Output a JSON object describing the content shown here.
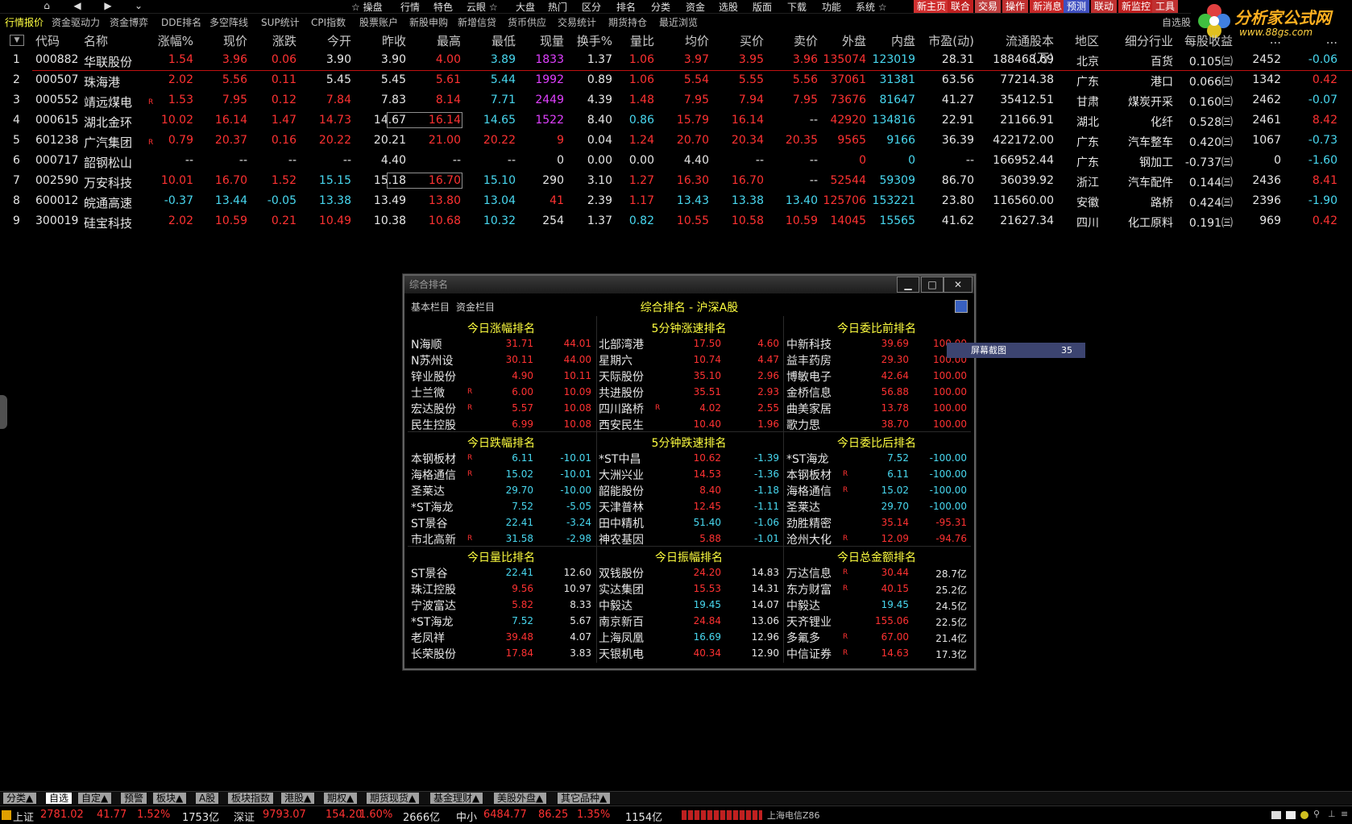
{
  "top_nav": {
    "buttons": [
      "⌂",
      "◀",
      "▶",
      "⌄"
    ],
    "items": [
      "☆ 操盘",
      "行情",
      "特色",
      "云眼 ☆",
      "大盘",
      "热门",
      "区分",
      "排名",
      "分类",
      "资金",
      "选股",
      "版面",
      "下载",
      "功能",
      "系统 ☆"
    ],
    "quick": [
      {
        "label": "新主页",
        "bg": "#d03030"
      },
      {
        "label": "联合",
        "bg": "#c02020"
      },
      {
        "label": "交易",
        "bg": "#c04040"
      },
      {
        "label": "操作",
        "bg": "#c03030"
      },
      {
        "label": "新消息",
        "bg": "#c82828"
      },
      {
        "label": "预测",
        "bg": "#4050c0"
      },
      {
        "label": "联动",
        "bg": "#c03030"
      },
      {
        "label": "新监控",
        "bg": "#c02020"
      },
      {
        "label": "工具",
        "bg": "#c03030"
      }
    ]
  },
  "logo": {
    "text": "分析家公式网",
    "url_text": "www.88gs.com"
  },
  "tabs": [
    "行情报价",
    "资金驱动力",
    "资金博弈",
    "DDE排名",
    "多空阵线",
    "SUP统计",
    "CPI指数",
    "股票账户",
    "新股申购",
    "新增信贷",
    "货币供应",
    "交易统计",
    "期货持仓",
    "最近浏览"
  ],
  "right_tab": "自选股",
  "columns": [
    "代码",
    "名称",
    "涨幅%",
    "现价",
    "涨跌",
    "今开",
    "昨收",
    "最高",
    "最低",
    "现量",
    "换手%",
    "量比",
    "均价",
    "买价",
    "卖价",
    "外盘",
    "内盘",
    "市盈(动)",
    "流通股本(万)",
    "地区",
    "细分行业",
    "每股收益",
    "...",
    "..."
  ],
  "rows": [
    {
      "n": "1",
      "code": "000882",
      "name": "华联股份",
      "r": false,
      "vals": [
        "1.54",
        "3.96",
        "0.06",
        "3.90",
        "3.90",
        "4.00",
        "3.89",
        "1833",
        "1.37",
        "1.06",
        "3.97",
        "3.95",
        "3.96",
        "135074",
        "123019",
        "28.31",
        "188468.69",
        "北京",
        "百货",
        "0.105㈢",
        "2452",
        "-0.06"
      ],
      "cls": [
        "r",
        "r",
        "r",
        "w",
        "w",
        "r",
        "c",
        "m",
        "w",
        "r",
        "r",
        "r",
        "r",
        "r",
        "c",
        "w",
        "w",
        "w",
        "w",
        "w",
        "w",
        "c"
      ]
    },
    {
      "n": "2",
      "code": "000507",
      "name": "珠海港",
      "r": false,
      "vals": [
        "2.02",
        "5.56",
        "0.11",
        "5.45",
        "5.45",
        "5.61",
        "5.44",
        "1992",
        "0.89",
        "1.06",
        "5.54",
        "5.55",
        "5.56",
        "37061",
        "31381",
        "63.56",
        "77214.38",
        "广东",
        "港口",
        "0.066㈢",
        "1342",
        "0.42"
      ],
      "cls": [
        "r",
        "r",
        "r",
        "w",
        "w",
        "r",
        "c",
        "m",
        "w",
        "r",
        "r",
        "r",
        "r",
        "r",
        "c",
        "w",
        "w",
        "w",
        "w",
        "w",
        "w",
        "r"
      ]
    },
    {
      "n": "3",
      "code": "000552",
      "name": "靖远煤电",
      "r": true,
      "vals": [
        "1.53",
        "7.95",
        "0.12",
        "7.84",
        "7.83",
        "8.14",
        "7.71",
        "2449",
        "4.39",
        "1.48",
        "7.95",
        "7.94",
        "7.95",
        "73676",
        "81647",
        "41.27",
        "35412.51",
        "甘肃",
        "煤炭开采",
        "0.160㈢",
        "2462",
        "-0.07"
      ],
      "cls": [
        "r",
        "r",
        "r",
        "r",
        "w",
        "r",
        "c",
        "m",
        "w",
        "r",
        "r",
        "r",
        "r",
        "r",
        "c",
        "w",
        "w",
        "w",
        "w",
        "w",
        "w",
        "c"
      ]
    },
    {
      "n": "4",
      "code": "000615",
      "name": "湖北金环",
      "r": false,
      "vals": [
        "10.02",
        "16.14",
        "1.47",
        "14.73",
        "14.67",
        "16.14",
        "14.65",
        "1522",
        "8.40",
        "0.86",
        "15.79",
        "16.14",
        "--",
        "42920",
        "134816",
        "22.91",
        "21166.91",
        "湖北",
        "化纤",
        "0.528㈢",
        "2461",
        "8.42"
      ],
      "cls": [
        "r",
        "r",
        "r",
        "r",
        "w",
        "r",
        "c",
        "m",
        "w",
        "c",
        "r",
        "r",
        "w",
        "r",
        "c",
        "w",
        "w",
        "w",
        "w",
        "w",
        "w",
        "r"
      ]
    },
    {
      "n": "5",
      "code": "601238",
      "name": "广汽集团",
      "r": true,
      "vals": [
        "0.79",
        "20.37",
        "0.16",
        "20.22",
        "20.21",
        "21.00",
        "20.22",
        "9",
        "0.04",
        "1.24",
        "20.70",
        "20.34",
        "20.35",
        "9565",
        "9166",
        "36.39",
        "422172.00",
        "广东",
        "汽车整车",
        "0.420㈢",
        "1067",
        "-0.73"
      ],
      "cls": [
        "r",
        "r",
        "r",
        "r",
        "w",
        "r",
        "r",
        "r",
        "w",
        "r",
        "r",
        "r",
        "r",
        "r",
        "c",
        "w",
        "w",
        "w",
        "w",
        "w",
        "w",
        "c"
      ]
    },
    {
      "n": "6",
      "code": "000717",
      "name": "韶钢松山",
      "r": false,
      "vals": [
        "--",
        "--",
        "--",
        "--",
        "4.40",
        "--",
        "--",
        "0",
        "0.00",
        "0.00",
        "4.40",
        "--",
        "--",
        "0",
        "0",
        "--",
        "166952.44",
        "广东",
        "钢加工",
        "-0.737㈢",
        "0",
        "-1.60"
      ],
      "cls": [
        "w",
        "w",
        "w",
        "w",
        "w",
        "w",
        "w",
        "w",
        "w",
        "w",
        "w",
        "w",
        "w",
        "r",
        "c",
        "w",
        "w",
        "w",
        "w",
        "w",
        "w",
        "c"
      ]
    },
    {
      "n": "7",
      "code": "002590",
      "name": "万安科技",
      "r": false,
      "vals": [
        "10.01",
        "16.70",
        "1.52",
        "15.15",
        "15.18",
        "16.70",
        "15.10",
        "290",
        "3.10",
        "1.27",
        "16.30",
        "16.70",
        "--",
        "52544",
        "59309",
        "86.70",
        "36039.92",
        "浙江",
        "汽车配件",
        "0.144㈢",
        "2436",
        "8.41"
      ],
      "cls": [
        "r",
        "r",
        "r",
        "c",
        "w",
        "r",
        "c",
        "w",
        "w",
        "r",
        "r",
        "r",
        "w",
        "r",
        "c",
        "w",
        "w",
        "w",
        "w",
        "w",
        "w",
        "r"
      ]
    },
    {
      "n": "8",
      "code": "600012",
      "name": "皖通高速",
      "r": false,
      "vals": [
        "-0.37",
        "13.44",
        "-0.05",
        "13.38",
        "13.49",
        "13.80",
        "13.04",
        "41",
        "2.39",
        "1.17",
        "13.43",
        "13.38",
        "13.40",
        "125706",
        "153221",
        "23.80",
        "116560.00",
        "安徽",
        "路桥",
        "0.424㈢",
        "2396",
        "-1.90"
      ],
      "cls": [
        "c",
        "c",
        "c",
        "c",
        "w",
        "r",
        "c",
        "r",
        "w",
        "r",
        "c",
        "c",
        "c",
        "r",
        "c",
        "w",
        "w",
        "w",
        "w",
        "w",
        "w",
        "c"
      ]
    },
    {
      "n": "9",
      "code": "300019",
      "name": "硅宝科技",
      "r": false,
      "vals": [
        "2.02",
        "10.59",
        "0.21",
        "10.49",
        "10.38",
        "10.68",
        "10.32",
        "254",
        "1.37",
        "0.82",
        "10.55",
        "10.58",
        "10.59",
        "14045",
        "15565",
        "41.62",
        "21627.34",
        "四川",
        "化工原料",
        "0.191㈢",
        "969",
        "0.42"
      ],
      "cls": [
        "r",
        "r",
        "r",
        "r",
        "w",
        "r",
        "c",
        "w",
        "w",
        "c",
        "r",
        "r",
        "r",
        "r",
        "c",
        "w",
        "w",
        "w",
        "w",
        "w",
        "w",
        "r"
      ]
    }
  ],
  "popup": {
    "window_title": "综合排名",
    "tab1": "基本栏目",
    "tab2": "资金栏目",
    "heading": "综合排名 - 沪深A股",
    "panels": [
      {
        "title": "今日涨幅排名",
        "rows": [
          [
            "N海顺",
            "",
            "31.71",
            "44.01",
            "r",
            "r"
          ],
          [
            "N苏州设",
            "",
            "30.11",
            "44.00",
            "r",
            "r"
          ],
          [
            "锌业股份",
            "",
            "4.90",
            "10.11",
            "r",
            "r"
          ],
          [
            "士兰微",
            "R",
            "6.00",
            "10.09",
            "r",
            "r"
          ],
          [
            "宏达股份",
            "R",
            "5.57",
            "10.08",
            "r",
            "r"
          ],
          [
            "民生控股",
            "",
            "6.99",
            "10.08",
            "r",
            "r"
          ]
        ]
      },
      {
        "title": "5分钟涨速排名",
        "rows": [
          [
            "北部湾港",
            "",
            "17.50",
            "4.60",
            "r",
            "r"
          ],
          [
            "星期六",
            "",
            "10.74",
            "4.47",
            "r",
            "r"
          ],
          [
            "天际股份",
            "",
            "35.10",
            "2.96",
            "r",
            "r"
          ],
          [
            "共进股份",
            "",
            "35.51",
            "2.93",
            "r",
            "r"
          ],
          [
            "四川路桥",
            "R",
            "4.02",
            "2.55",
            "r",
            "r"
          ],
          [
            "西安民生",
            "",
            "10.40",
            "1.96",
            "r",
            "r"
          ]
        ]
      },
      {
        "title": "今日委比前排名",
        "rows": [
          [
            "中新科技",
            "",
            "39.69",
            "100.00",
            "r",
            "r"
          ],
          [
            "益丰药房",
            "",
            "29.30",
            "100.00",
            "r",
            "r"
          ],
          [
            "博敏电子",
            "",
            "42.64",
            "100.00",
            "r",
            "r"
          ],
          [
            "金桥信息",
            "",
            "56.88",
            "100.00",
            "r",
            "r"
          ],
          [
            "曲美家居",
            "",
            "13.78",
            "100.00",
            "r",
            "r"
          ],
          [
            "歌力思",
            "",
            "38.70",
            "100.00",
            "r",
            "r"
          ]
        ]
      },
      {
        "title": "今日跌幅排名",
        "rows": [
          [
            "本钢板材",
            "R",
            "6.11",
            "-10.01",
            "c",
            "c"
          ],
          [
            "海格通信",
            "R",
            "15.02",
            "-10.01",
            "c",
            "c"
          ],
          [
            "圣莱达",
            "",
            "29.70",
            "-10.00",
            "c",
            "c"
          ],
          [
            "*ST海龙",
            "",
            "7.52",
            "-5.05",
            "c",
            "c"
          ],
          [
            "ST景谷",
            "",
            "22.41",
            "-3.24",
            "c",
            "c"
          ],
          [
            "市北高新",
            "R",
            "31.58",
            "-2.98",
            "c",
            "c"
          ]
        ]
      },
      {
        "title": "5分钟跌速排名",
        "rows": [
          [
            "*ST中昌",
            "",
            "10.62",
            "-1.39",
            "r",
            "c"
          ],
          [
            "大洲兴业",
            "",
            "14.53",
            "-1.36",
            "r",
            "c"
          ],
          [
            "韶能股份",
            "",
            "8.40",
            "-1.18",
            "r",
            "c"
          ],
          [
            "天津普林",
            "",
            "12.45",
            "-1.11",
            "r",
            "c"
          ],
          [
            "田中精机",
            "",
            "51.40",
            "-1.06",
            "c",
            "c"
          ],
          [
            "神农基因",
            "",
            "5.88",
            "-1.01",
            "r",
            "c"
          ]
        ]
      },
      {
        "title": "今日委比后排名",
        "rows": [
          [
            "*ST海龙",
            "",
            "7.52",
            "-100.00",
            "c",
            "c"
          ],
          [
            "本钢板材",
            "R",
            "6.11",
            "-100.00",
            "c",
            "c"
          ],
          [
            "海格通信",
            "R",
            "15.02",
            "-100.00",
            "c",
            "c"
          ],
          [
            "圣莱达",
            "",
            "29.70",
            "-100.00",
            "c",
            "c"
          ],
          [
            "劲胜精密",
            "",
            "35.14",
            "-95.31",
            "r",
            "r"
          ],
          [
            "沧州大化",
            "R",
            "12.09",
            "-94.76",
            "r",
            "r"
          ]
        ]
      },
      {
        "title": "今日量比排名",
        "rows": [
          [
            "ST景谷",
            "",
            "22.41",
            "12.60",
            "c",
            "w"
          ],
          [
            "珠江控股",
            "",
            "9.56",
            "10.97",
            "r",
            "w"
          ],
          [
            "宁波富达",
            "",
            "5.82",
            "8.33",
            "r",
            "w"
          ],
          [
            "*ST海龙",
            "",
            "7.52",
            "5.67",
            "c",
            "w"
          ],
          [
            "老凤祥",
            "",
            "39.48",
            "4.07",
            "r",
            "w"
          ],
          [
            "长荣股份",
            "",
            "17.84",
            "3.83",
            "r",
            "w"
          ]
        ]
      },
      {
        "title": "今日振幅排名",
        "rows": [
          [
            "双钱股份",
            "",
            "24.20",
            "14.83",
            "r",
            "w"
          ],
          [
            "实达集团",
            "",
            "15.53",
            "14.31",
            "r",
            "w"
          ],
          [
            "中毅达",
            "",
            "19.45",
            "14.07",
            "c",
            "w"
          ],
          [
            "南京新百",
            "",
            "24.84",
            "13.06",
            "r",
            "w"
          ],
          [
            "上海凤凰",
            "",
            "16.69",
            "12.96",
            "c",
            "w"
          ],
          [
            "天银机电",
            "",
            "40.34",
            "12.90",
            "r",
            "w"
          ]
        ]
      },
      {
        "title": "今日总金额排名",
        "rows": [
          [
            "万达信息",
            "R",
            "30.44",
            "28.7亿",
            "r",
            "w"
          ],
          [
            "东方财富",
            "R",
            "40.15",
            "25.2亿",
            "r",
            "w"
          ],
          [
            "中毅达",
            "",
            "19.45",
            "24.5亿",
            "c",
            "w"
          ],
          [
            "天齐锂业",
            "",
            "155.06",
            "22.5亿",
            "r",
            "w"
          ],
          [
            "多氟多",
            "R",
            "67.00",
            "21.4亿",
            "r",
            "w"
          ],
          [
            "中信证券",
            "R",
            "14.63",
            "17.3亿",
            "r",
            "w"
          ]
        ]
      }
    ]
  },
  "tooltip": {
    "label": "屏幕截图",
    "value": "35"
  },
  "bottom_tabs": [
    "分类▲",
    "自选",
    "自定▲",
    "预警",
    "板块▲",
    "A股",
    "板块指数",
    "港股▲",
    "期权▲",
    "期货现货▲",
    "基金理财▲",
    "美股外盘▲",
    "其它品种▲"
  ],
  "status": {
    "sh_label": "上证",
    "sh_val": "2781.02",
    "sh_chg": "41.77",
    "sh_pct": "1.52%",
    "sh_amt": "1753亿",
    "sz_label": "深证",
    "sz_val": "9793.07",
    "sz_chg": "154.20",
    "sz_pct": "1.60%",
    "sz_amt": "2666亿",
    "zx_label": "中小",
    "zx_val": "6484.77",
    "zx_chg": "86.25",
    "zx_pct": "1.35%",
    "zx_amt": "1154亿",
    "server": "上海电信Z86"
  }
}
